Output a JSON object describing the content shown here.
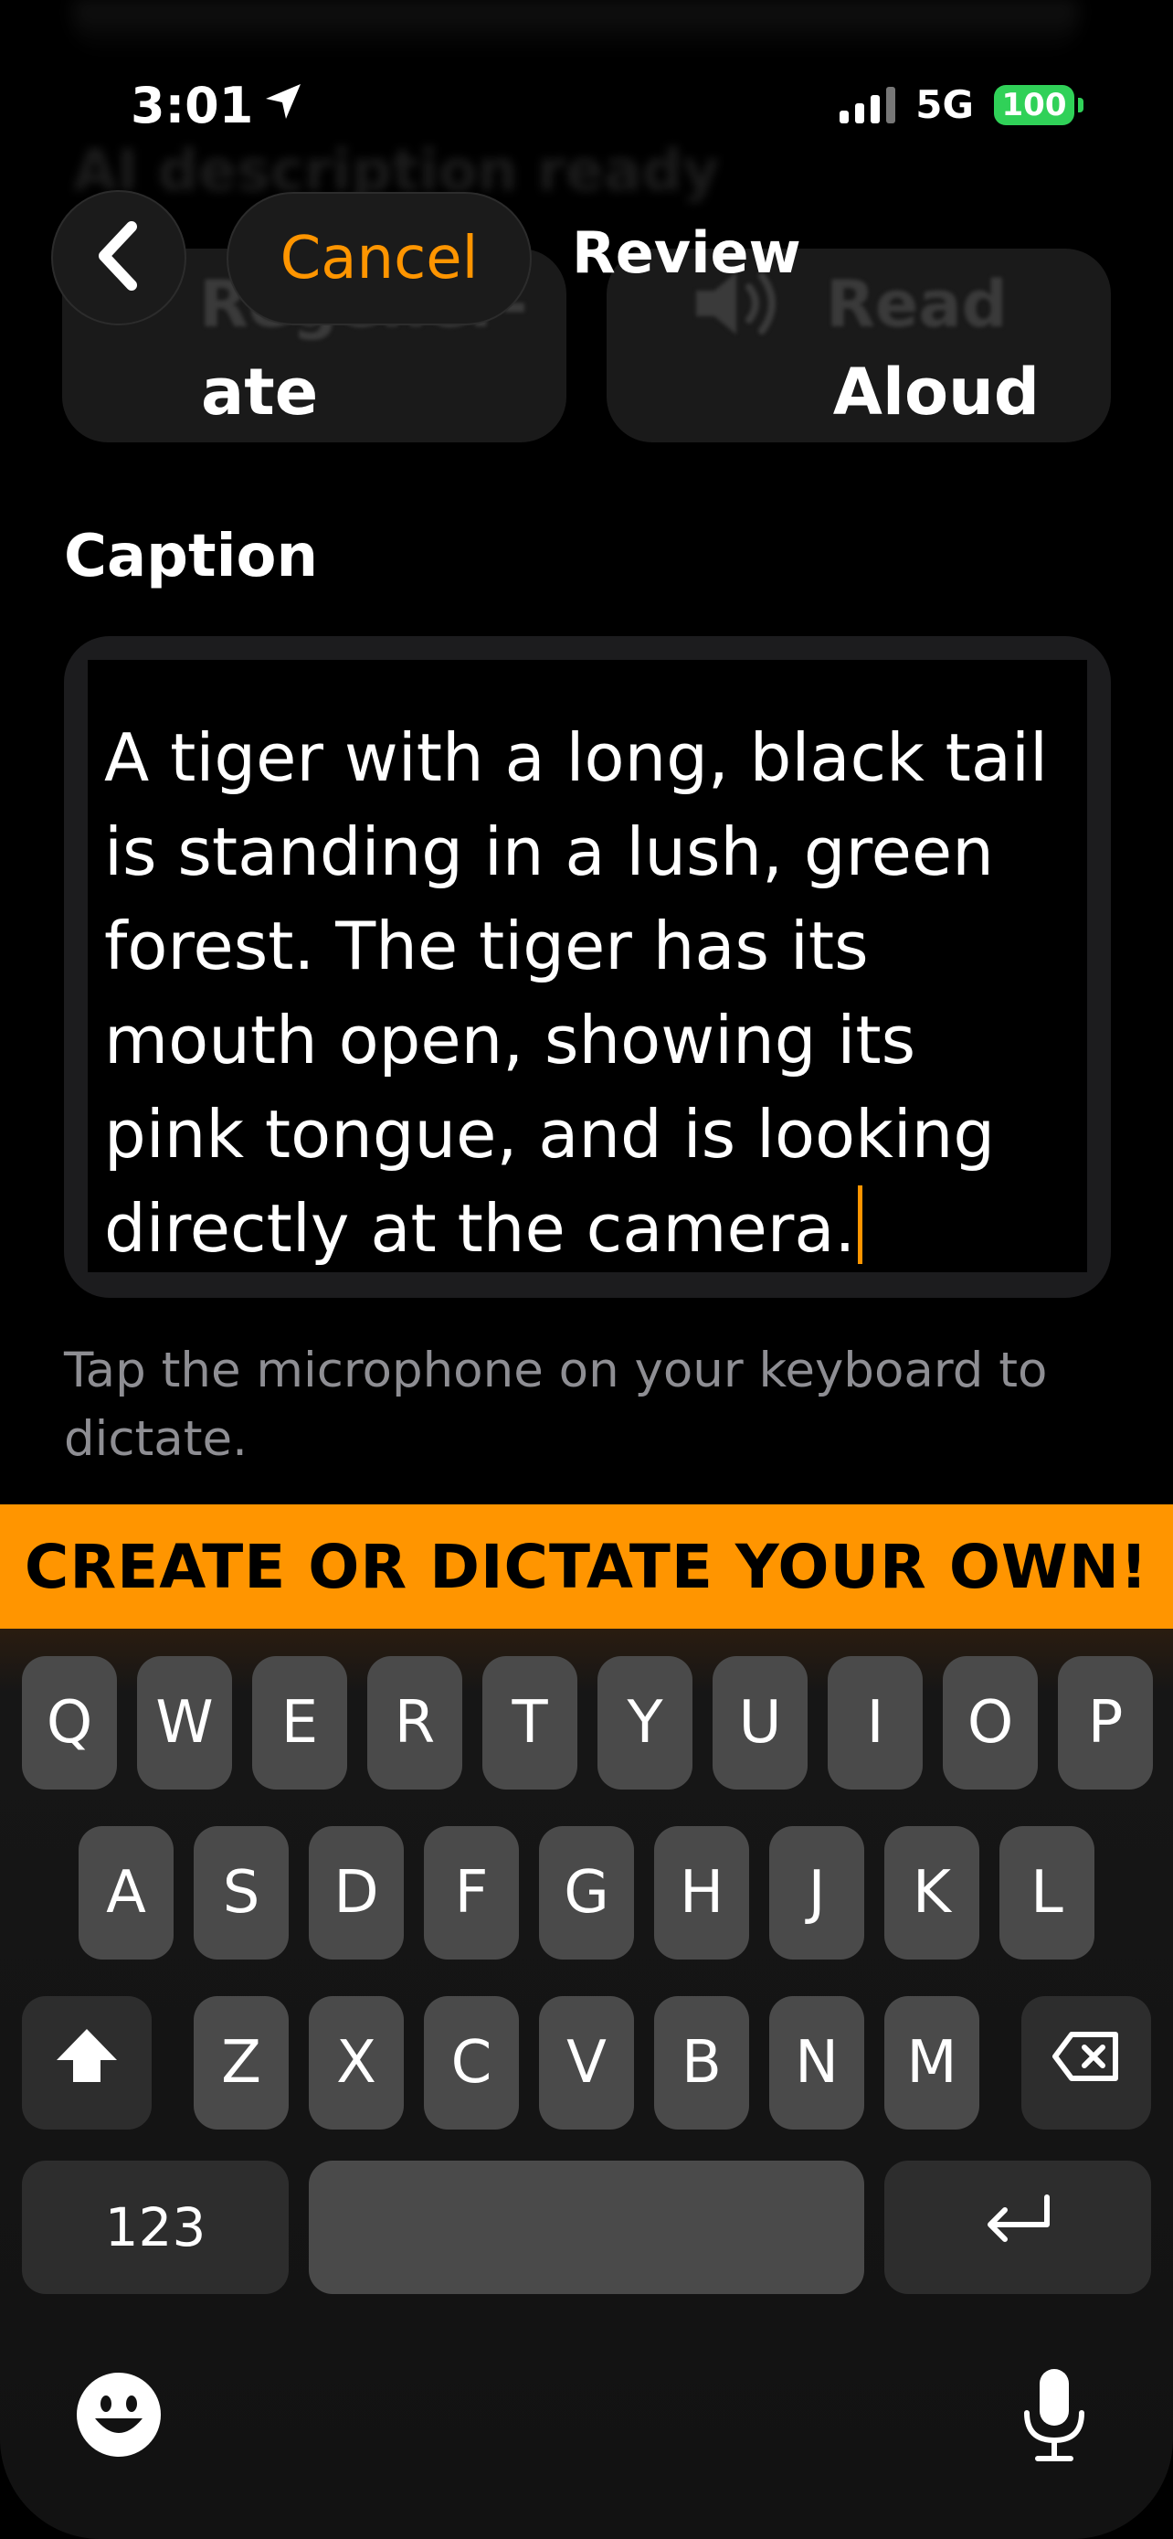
{
  "status": {
    "time": "3:01",
    "network": "5G",
    "battery": "100"
  },
  "nav": {
    "cancel_label": "Cancel",
    "title": "Review"
  },
  "background": {
    "ghost_text": "AI description ready"
  },
  "actions": [
    {
      "ghost": "Regener-",
      "label": "ate",
      "icon": "sparkle-icon"
    },
    {
      "ghost": "Read",
      "label": "Aloud",
      "icon": "speaker-icon"
    }
  ],
  "caption": {
    "heading": "Caption",
    "text": "A tiger with a long, black tail is standing in a lush, green forest. The tiger has its mouth open, showing its pink tongue, and is looking directly at the camera.",
    "hint": "Tap the microphone on your keyboard to dictate."
  },
  "banner": {
    "text": "CREATE OR DICTATE YOUR OWN!"
  },
  "keyboard": {
    "row1": [
      "Q",
      "W",
      "E",
      "R",
      "T",
      "Y",
      "U",
      "I",
      "O",
      "P"
    ],
    "row2": [
      "A",
      "S",
      "D",
      "F",
      "G",
      "H",
      "J",
      "K",
      "L"
    ],
    "row3": [
      "Z",
      "X",
      "C",
      "V",
      "B",
      "N",
      "M"
    ],
    "numbers_label": "123"
  },
  "colors": {
    "accent": "#ff9500",
    "battery": "#30d158",
    "background": "#000000"
  }
}
